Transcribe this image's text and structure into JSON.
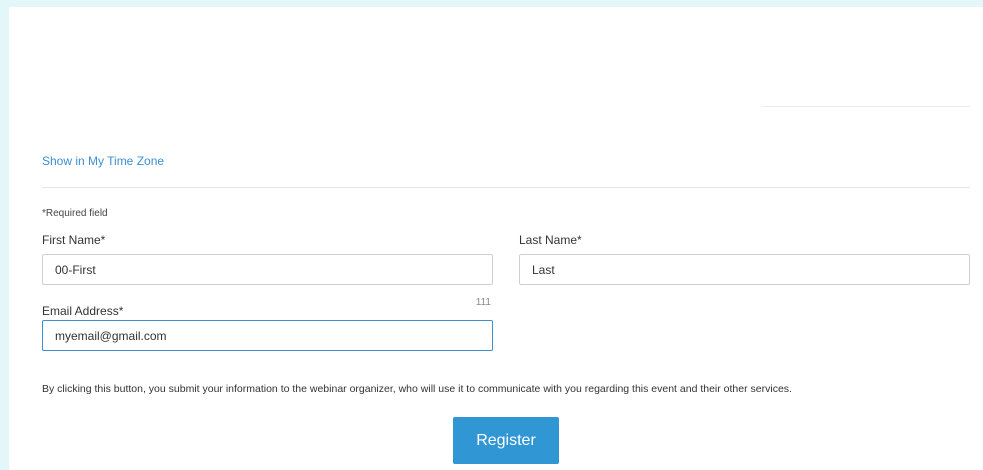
{
  "timezone_link": "Show in My Time Zone",
  "form": {
    "required_note": "*Required field",
    "first_name": {
      "label": "First Name*",
      "value": "00-First"
    },
    "last_name": {
      "label": "Last Name*",
      "value": "Last"
    },
    "email": {
      "label": "Email Address*",
      "value": "myemail@gmail.com",
      "char_count": "111"
    }
  },
  "consent_text": "By clicking this button, you submit your information to the webinar organizer, who will use it to communicate with you regarding this event and their other services.",
  "register_label": "Register",
  "colors": {
    "page_background": "#e3f6f9",
    "accent": "#3196d4",
    "link": "#3c8fd0"
  }
}
